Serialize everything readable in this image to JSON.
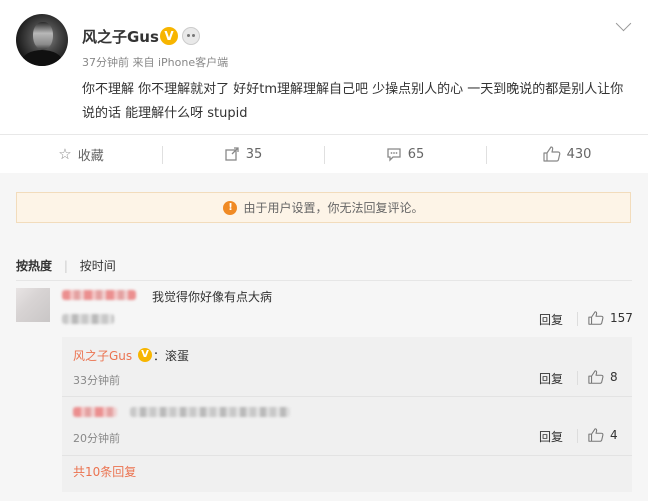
{
  "post": {
    "author": "风之子Gus",
    "verified_badge": "V",
    "meta": "37分钟前 来自 iPhone客户端",
    "text": "你不理解 你不理解就对了 好好tm理解理解自己吧 少操点别人的心 一天到晚说的都是别人让你说的话 能理解什么呀 stupid"
  },
  "actions": {
    "favorite": "收藏",
    "repost": "35",
    "comment": "65",
    "like": "430"
  },
  "notice": "由于用户设置，你无法回复评论。",
  "sort": {
    "by_hot": "按热度",
    "by_time": "按时间"
  },
  "comments": [
    {
      "text": "我觉得你好像有点大病",
      "reply_label": "回复",
      "likes": "157"
    }
  ],
  "replies": [
    {
      "author": "风之子Gus",
      "badge": "V",
      "text": "：滚蛋",
      "time": "33分钟前",
      "reply_label": "回复",
      "likes": "8"
    },
    {
      "time": "20分钟前",
      "reply_label": "回复",
      "likes": "4"
    }
  ],
  "more_replies": "共10条回复",
  "colors": {
    "accent": "#eb7350",
    "badge": "#f7b500",
    "notice_bg": "#fdf4e7",
    "warn": "#f08a24"
  }
}
